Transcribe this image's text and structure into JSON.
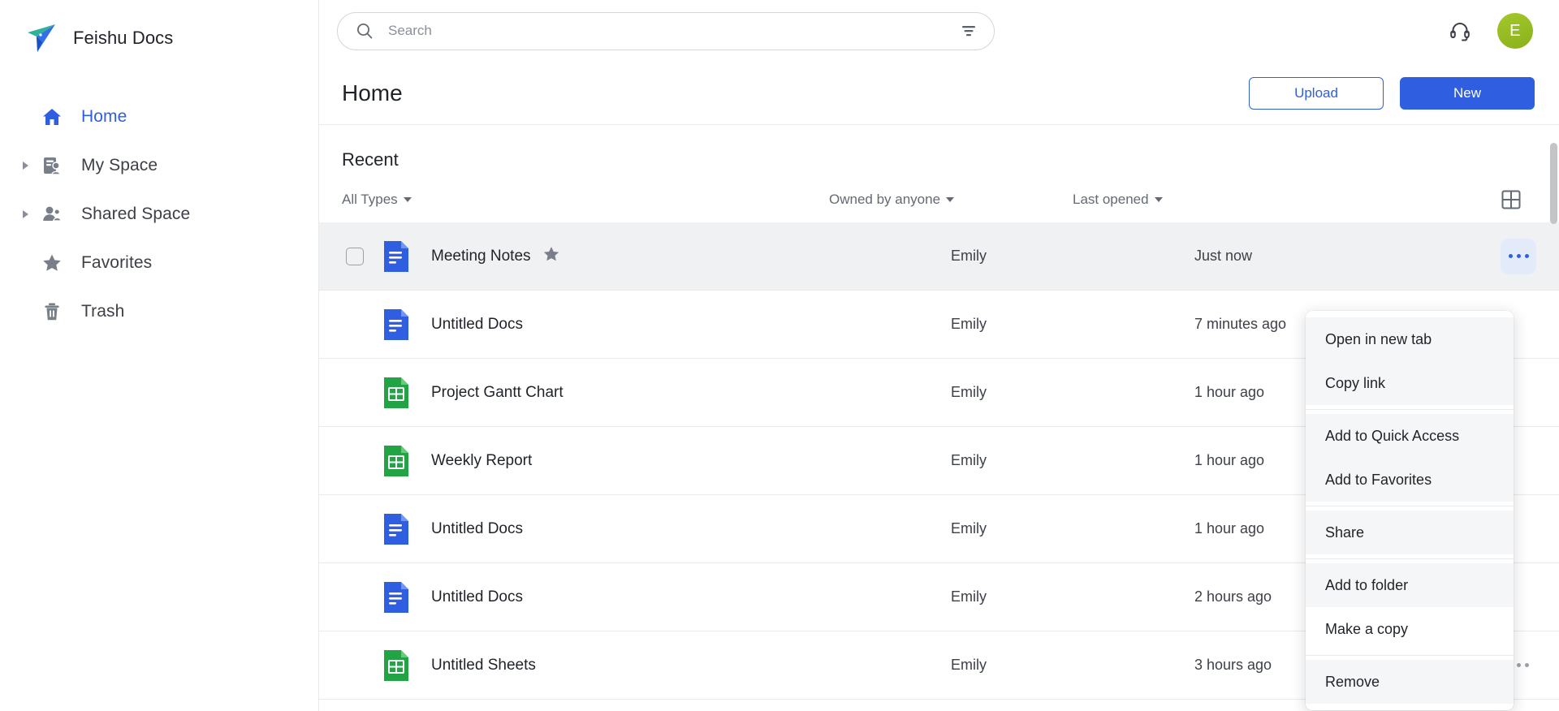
{
  "brand": {
    "title": "Feishu Docs",
    "logo_icon": "paper-plane-icon"
  },
  "sidebar": {
    "items": [
      {
        "label": "Home",
        "icon": "home-icon",
        "active": true,
        "expandable": false
      },
      {
        "label": "My Space",
        "icon": "my-space-icon",
        "active": false,
        "expandable": true
      },
      {
        "label": "Shared Space",
        "icon": "shared-space-icon",
        "active": false,
        "expandable": true
      },
      {
        "label": "Favorites",
        "icon": "star-icon",
        "active": false,
        "expandable": false
      },
      {
        "label": "Trash",
        "icon": "trash-icon",
        "active": false,
        "expandable": false
      }
    ]
  },
  "topbar": {
    "search": {
      "placeholder": "Search",
      "value": "",
      "icon": "search-icon",
      "filter_icon": "filter-icon"
    },
    "support_icon": "headset-icon",
    "avatar": {
      "initial": "E",
      "color": "#9ABF22"
    }
  },
  "page": {
    "title": "Home",
    "upload_label": "Upload",
    "new_label": "New",
    "accent": "#2F5FE0"
  },
  "section": {
    "title": "Recent",
    "filters": {
      "types": "All Types",
      "owner": "Owned by anyone",
      "opened": "Last opened"
    },
    "view_toggle_icon": "grid-view-icon"
  },
  "rows": [
    {
      "name": "Meeting Notes",
      "type": "doc",
      "starred": true,
      "owner": "Emily",
      "opened": "Just now",
      "selected": true
    },
    {
      "name": "Untitled Docs",
      "type": "doc",
      "starred": false,
      "owner": "Emily",
      "opened": "7 minutes ago",
      "selected": false
    },
    {
      "name": "Project Gantt Chart",
      "type": "sheet",
      "starred": false,
      "owner": "Emily",
      "opened": "1 hour ago",
      "selected": false
    },
    {
      "name": "Weekly Report",
      "type": "sheet",
      "starred": false,
      "owner": "Emily",
      "opened": "1 hour ago",
      "selected": false
    },
    {
      "name": "Untitled Docs",
      "type": "doc",
      "starred": false,
      "owner": "Emily",
      "opened": "1 hour ago",
      "selected": false
    },
    {
      "name": "Untitled Docs",
      "type": "doc",
      "starred": false,
      "owner": "Emily",
      "opened": "2 hours ago",
      "selected": false
    },
    {
      "name": "Untitled Sheets",
      "type": "sheet",
      "starred": false,
      "owner": "Emily",
      "opened": "3 hours ago",
      "selected": false
    }
  ],
  "context_menu": {
    "visible": true,
    "hovered_item": "Make a copy",
    "groups": [
      {
        "items": [
          "Open in new tab",
          "Copy link"
        ]
      },
      {
        "items": [
          "Add to Quick Access",
          "Add to Favorites"
        ]
      },
      {
        "items": [
          "Share"
        ]
      },
      {
        "items": [
          "Add to folder",
          "Make a copy"
        ]
      },
      {
        "items": [
          "Remove"
        ]
      }
    ]
  }
}
